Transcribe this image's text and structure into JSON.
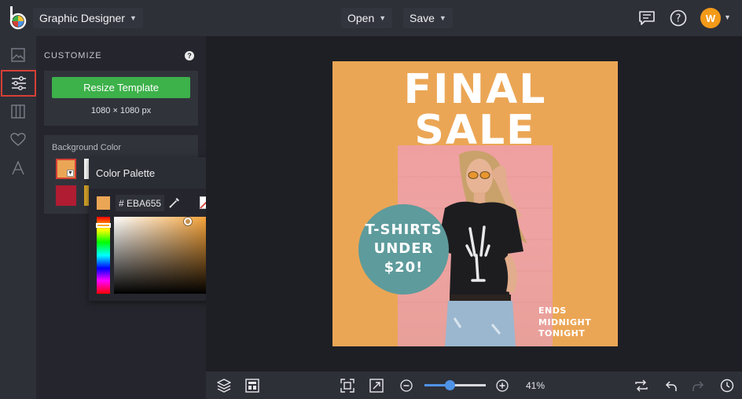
{
  "topbar": {
    "app_name": "Graphic Designer",
    "open_label": "Open",
    "save_label": "Save",
    "user_initial": "W"
  },
  "panel": {
    "heading": "CUSTOMIZE",
    "help_glyph": "?",
    "resize_label": "Resize Template",
    "dimensions": "1080 × 1080 px",
    "background_label": "Background Color",
    "swatch_colors": [
      "#eba655",
      "#ffffff",
      "#b01c32",
      "#d9a62a"
    ]
  },
  "color_palette": {
    "title": "Color Palette",
    "hex_value": "# EBA655",
    "current_color": "#eba655",
    "hue_position": 0.08
  },
  "design": {
    "title_line1": "FINAL",
    "title_line2": "SALE",
    "badge_line1": "T-SHIRTS",
    "badge_line2": "UNDER",
    "badge_line3": "$20!",
    "ends_line1": "ENDS",
    "ends_line2": "MIDNIGHT",
    "ends_line3": "TONIGHT",
    "background": "#eba655",
    "badge_color": "#5e9b9c"
  },
  "bottombar": {
    "zoom_label": "41%",
    "zoom_fraction": 0.41
  },
  "colors": {
    "accent_green": "#3db14a",
    "active_outline": "#d64035",
    "zoom_blue": "#4f93e6"
  }
}
